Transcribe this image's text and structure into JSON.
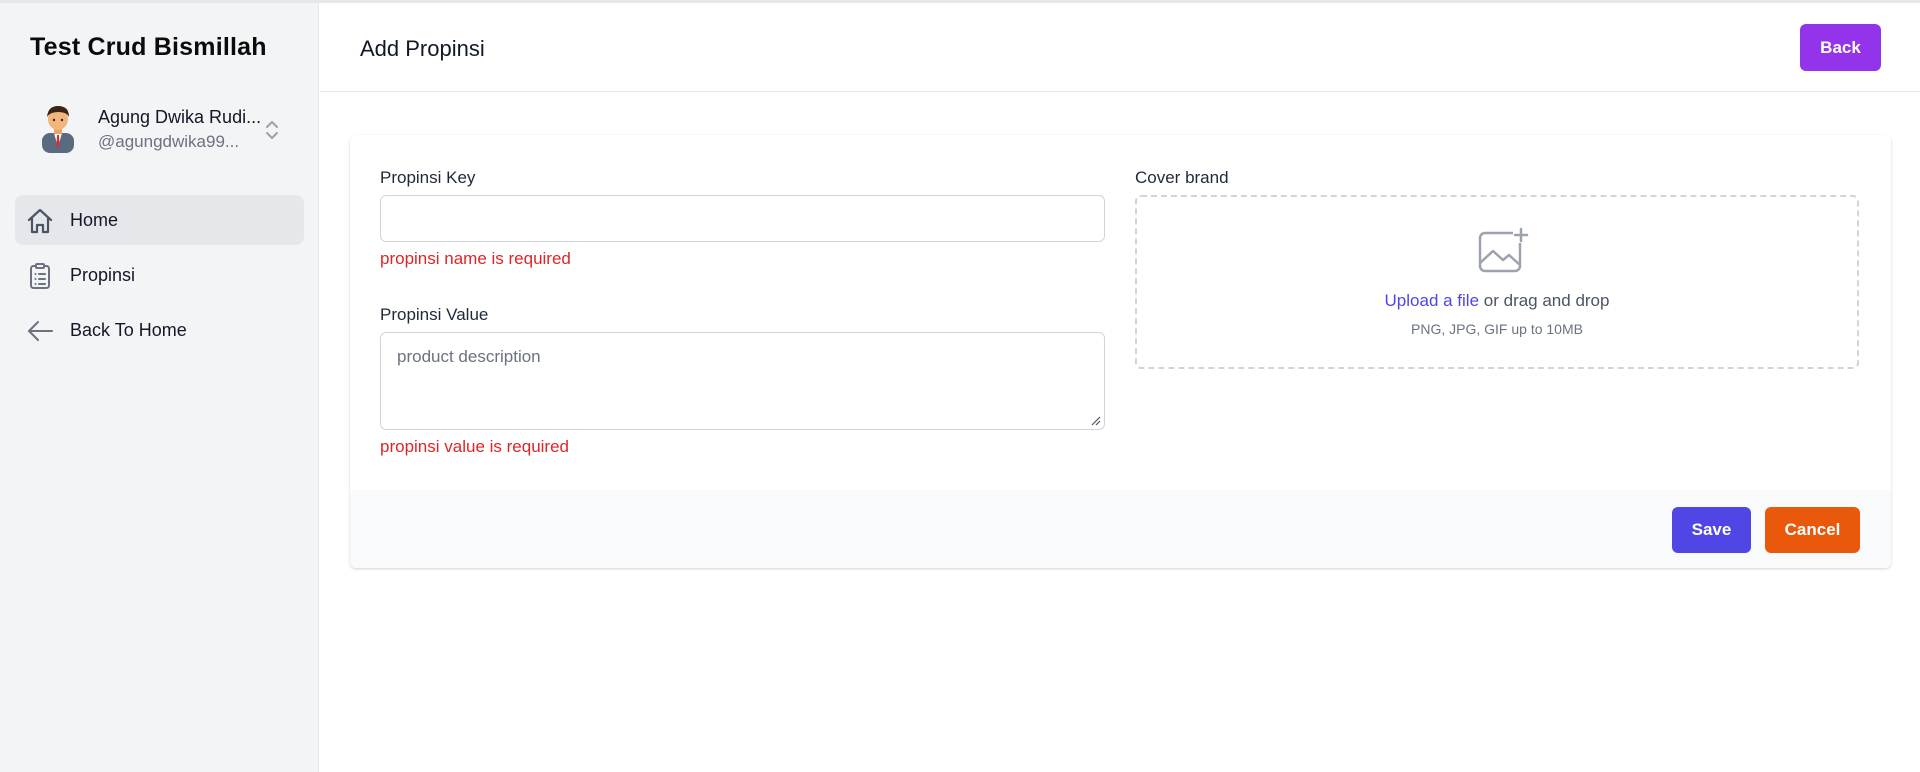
{
  "app": {
    "title": "Test Crud Bismillah"
  },
  "user": {
    "name": "Agung Dwika Rudi...",
    "handle": "@agungdwika99..."
  },
  "sidebar": {
    "items": [
      {
        "label": "Home",
        "icon": "home-icon",
        "active": true
      },
      {
        "label": "Propinsi",
        "icon": "clipboard-list-icon",
        "active": false
      },
      {
        "label": "Back To Home",
        "icon": "arrow-left-icon",
        "active": false
      }
    ]
  },
  "header": {
    "title": "Add Propinsi",
    "back_label": "Back"
  },
  "form": {
    "key": {
      "label": "Propinsi Key",
      "value": "",
      "error": "propinsi name is required"
    },
    "value": {
      "label": "Propinsi Value",
      "placeholder": "product description",
      "error": "propinsi value is required"
    },
    "cover": {
      "label": "Cover brand",
      "upload_link": "Upload a file",
      "upload_rest": " or drag and drop",
      "hint": "PNG, JPG, GIF up to 10MB"
    },
    "save_label": "Save",
    "cancel_label": "Cancel"
  },
  "colors": {
    "back_button": "#9333ea",
    "save_button": "#4f46e5",
    "cancel_button": "#ea580c",
    "error": "#dc2626",
    "link": "#4f46e5",
    "sidebar_bg": "#f3f4f6"
  }
}
